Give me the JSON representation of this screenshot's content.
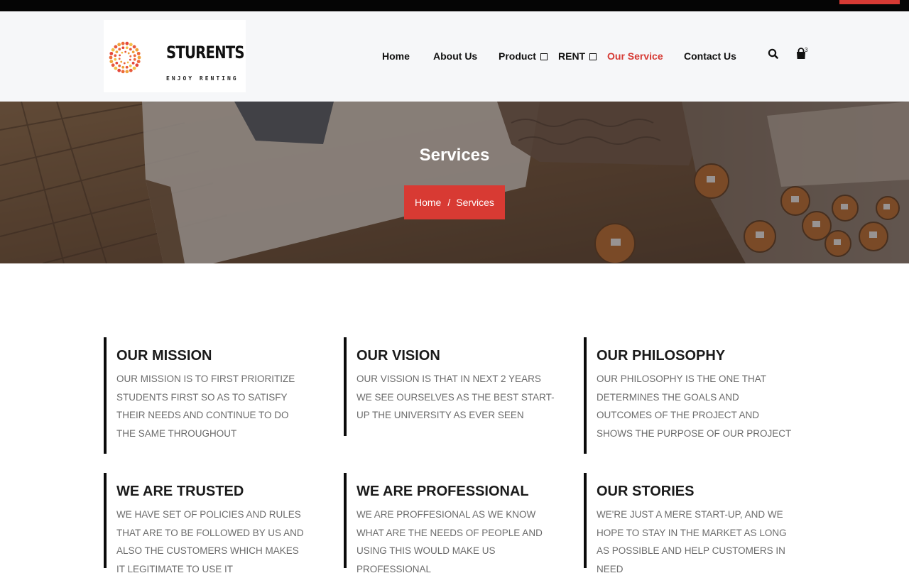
{
  "brand": {
    "name": "STURENTS",
    "tagline": "ENJOY RENTING",
    "accent_color": "#d63a34"
  },
  "nav": {
    "items": [
      {
        "label": "Home",
        "dropdown": false,
        "active": false
      },
      {
        "label": "About Us",
        "dropdown": false,
        "active": false
      },
      {
        "label": "Product",
        "dropdown": true,
        "active": false
      },
      {
        "label": "RENT",
        "dropdown": true,
        "active": false
      },
      {
        "label": "Our Service",
        "dropdown": false,
        "active": true
      },
      {
        "label": "Contact Us",
        "dropdown": false,
        "active": false
      }
    ],
    "search_icon": "search-icon",
    "cart_icon": "shopping-bag-icon",
    "cart_count": "3"
  },
  "hero": {
    "title": "Services",
    "breadcrumb": {
      "home": "Home",
      "separator": "/",
      "current": "Services"
    }
  },
  "services": [
    {
      "title": "OUR MISSION",
      "text": "OUR MISSION IS TO FIRST PRIORITIZE STUDENTS FIRST SO AS TO SATISFY THEIR NEEDS AND CONTINUE TO DO THE SAME THROUGHOUT"
    },
    {
      "title": "OUR VISION",
      "text": "OUR VISSION IS THAT IN NEXT 2 YEARS WE SEE OURSELVES AS THE BEST START-UP THE UNIVERSITY AS EVER SEEN"
    },
    {
      "title": "OUR PHILOSOPHY",
      "text": "OUR PHILOSOPHY IS THE ONE THAT DETERMINES THE GOALS AND OUTCOMES OF THE PROJECT AND SHOWS THE PURPOSE OF OUR PROJECT"
    },
    {
      "title": "WE ARE TRUSTED",
      "text": "WE HAVE SET OF POLICIES AND RULES THAT ARE TO BE FOLLOWED BY US AND ALSO THE CUSTOMERS WHICH MAKES IT LEGITIMATE TO USE IT"
    },
    {
      "title": "WE ARE PROFESSIONAL",
      "text": "WE ARE PROFFESIONAL AS WE KNOW WHAT ARE THE NEEDS OF PEOPLE AND USING THIS WOULD MAKE US PROFESSIONAL"
    },
    {
      "title": "OUR STORIES",
      "text": "WE'RE JUST A MERE START-UP, AND WE HOPE TO STAY IN THE MARKET AS LONG AS POSSIBLE AND HELP CUSTOMERS IN NEED"
    }
  ]
}
